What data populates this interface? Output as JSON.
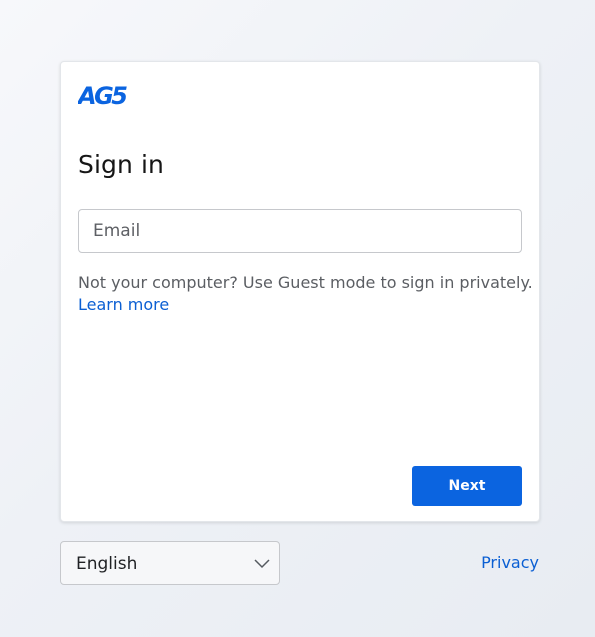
{
  "brand": {
    "logo_text": "AG5",
    "color": "#0b64e0"
  },
  "signin": {
    "title": "Sign in",
    "email_placeholder": "Email",
    "email_value": "",
    "guest_notice": "Not your computer? Use Guest mode to sign in privately.",
    "learn_more_label": "Learn more",
    "next_label": "Next"
  },
  "footer": {
    "language": {
      "selected": "English",
      "icon": "chevron-down-icon"
    },
    "privacy_label": "Privacy"
  },
  "colors": {
    "accent": "#0b64e0",
    "link": "#0b5fd3"
  }
}
